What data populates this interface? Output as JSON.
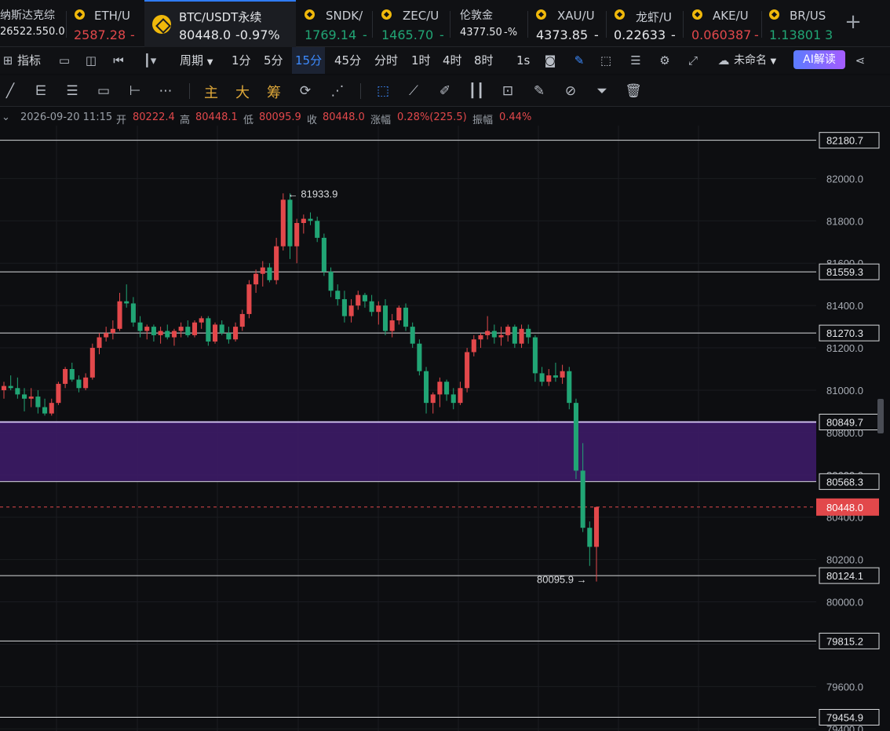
{
  "tickers": [
    {
      "name": "纳斯达克综",
      "price": "26522.55",
      "change": "0.0",
      "trend": "neu",
      "logo": "none"
    },
    {
      "name": "ETH/U",
      "price": "2587.28",
      "change": "-",
      "trend": "down",
      "logo": "coin-dot-icon"
    },
    {
      "name": "BTC/USDT永续",
      "price": "80448.0",
      "change": "-0.97%",
      "trend": "neu",
      "logo": "binance-icon",
      "active": true
    },
    {
      "name": "SNDK/",
      "price": "1769.14",
      "change": "-",
      "trend": "up",
      "logo": "coin-dot-icon"
    },
    {
      "name": "ZEC/U",
      "price": "1465.70",
      "change": "-",
      "trend": "up",
      "logo": "coin-dot-icon"
    },
    {
      "name": "伦敦金",
      "price": "4377.50",
      "change": "-%",
      "trend": "neu",
      "logo": "none"
    },
    {
      "name": "XAU/U",
      "price": "4373.85",
      "change": "-",
      "trend": "neu",
      "logo": "coin-dot-icon"
    },
    {
      "name": "龙虾/U",
      "price": "0.22633",
      "change": "-",
      "trend": "neu",
      "logo": "coin-dot-icon"
    },
    {
      "name": "AKE/U",
      "price": "0.060387",
      "change": "-",
      "trend": "down",
      "logo": "coin-dot-icon"
    },
    {
      "name": "BR/US",
      "price": "1.13801",
      "change": "3",
      "trend": "up",
      "logo": "coin-dot-icon"
    }
  ],
  "toolbar": {
    "indicators": "指标",
    "period": "周期",
    "intervals": [
      "1分",
      "5分",
      "15分",
      "45分",
      "分时",
      "1时",
      "4时",
      "8时",
      "1s"
    ],
    "active_interval": "15分",
    "layout_name": "未命名",
    "ai_label": "AI解读"
  },
  "drawbar": {
    "main": "主",
    "big": "大",
    "chip": "筹"
  },
  "info": {
    "datetime": "2026-09-20 11:15",
    "open_label": "开",
    "open": "80222.4",
    "high_label": "高",
    "high": "80448.1",
    "low_label": "低",
    "low": "80095.9",
    "close_label": "收",
    "close": "80448.0",
    "change_label": "涨幅",
    "change": "0.28%(225.5)",
    "amplitude_label": "振幅",
    "amplitude": "0.44%"
  },
  "chart_data": {
    "type": "candlestick",
    "symbol": "BTC/USDT永续",
    "interval": "15分",
    "ylim": [
      79390,
      82250
    ],
    "yticks": [
      82000.0,
      81800.0,
      81600.0,
      81400.0,
      81200.0,
      81000.0,
      80800.0,
      80600.0,
      80400.0,
      80200.0,
      80000.0,
      79800.0,
      79600.0,
      79400.0
    ],
    "horizontal_levels": [
      82180.7,
      81559.3,
      81270.3,
      80849.7,
      80568.3,
      80124.1,
      79815.2,
      79454.9
    ],
    "zone": {
      "from": 80568.3,
      "to": 80849.7,
      "color": "#3a1a63"
    },
    "last_price": 80448.0,
    "max_marker": "81933.9",
    "min_marker": "80095.9",
    "colors": {
      "up": "#e2484b",
      "down": "#21a575",
      "last": "#e2484b",
      "zone_edge": "#b78cff"
    },
    "candles": [
      [
        81000,
        81040,
        80960,
        81020
      ],
      [
        81020,
        81070,
        81000,
        81010
      ],
      [
        81010,
        81060,
        80960,
        80980
      ],
      [
        80980,
        81010,
        80900,
        80960
      ],
      [
        80960,
        81010,
        80920,
        80970
      ],
      [
        80970,
        81000,
        80890,
        80920
      ],
      [
        80920,
        80960,
        80880,
        80890
      ],
      [
        80890,
        80960,
        80880,
        80940
      ],
      [
        80940,
        81040,
        80930,
        81030
      ],
      [
        81030,
        81110,
        81010,
        81100
      ],
      [
        81100,
        81130,
        81040,
        81050
      ],
      [
        81050,
        81070,
        80990,
        81010
      ],
      [
        81010,
        81080,
        81000,
        81060
      ],
      [
        81060,
        81220,
        81050,
        81200
      ],
      [
        81200,
        81270,
        81170,
        81250
      ],
      [
        81250,
        81300,
        81230,
        81270
      ],
      [
        81270,
        81330,
        81240,
        81290
      ],
      [
        81290,
        81460,
        81280,
        81420
      ],
      [
        81420,
        81500,
        81390,
        81410
      ],
      [
        81410,
        81440,
        81300,
        81320
      ],
      [
        81320,
        81350,
        81250,
        81280
      ],
      [
        81280,
        81310,
        81240,
        81300
      ],
      [
        81300,
        81310,
        81230,
        81260
      ],
      [
        81260,
        81300,
        81220,
        81280
      ],
      [
        81280,
        81310,
        81240,
        81250
      ],
      [
        81250,
        81290,
        81210,
        81280
      ],
      [
        81280,
        81320,
        81250,
        81300
      ],
      [
        81300,
        81330,
        81250,
        81260
      ],
      [
        81260,
        81330,
        81250,
        81320
      ],
      [
        81320,
        81350,
        81290,
        81340
      ],
      [
        81340,
        81350,
        81210,
        81230
      ],
      [
        81230,
        81320,
        81220,
        81310
      ],
      [
        81310,
        81330,
        81260,
        81270
      ],
      [
        81270,
        81300,
        81220,
        81240
      ],
      [
        81240,
        81320,
        81230,
        81300
      ],
      [
        81300,
        81380,
        81280,
        81360
      ],
      [
        81360,
        81520,
        81340,
        81500
      ],
      [
        81500,
        81570,
        81460,
        81550
      ],
      [
        81550,
        81610,
        81490,
        81580
      ],
      [
        81580,
        81600,
        81510,
        81520
      ],
      [
        81520,
        81720,
        81500,
        81680
      ],
      [
        81680,
        81930,
        81660,
        81900
      ],
      [
        81900,
        81930,
        81620,
        81680
      ],
      [
        81680,
        81810,
        81600,
        81790
      ],
      [
        81790,
        81830,
        81740,
        81810
      ],
      [
        81810,
        81840,
        81780,
        81800
      ],
      [
        81800,
        81820,
        81700,
        81720
      ],
      [
        81720,
        81740,
        81540,
        81560
      ],
      [
        81560,
        81580,
        81440,
        81470
      ],
      [
        81470,
        81500,
        81400,
        81430
      ],
      [
        81430,
        81470,
        81320,
        81350
      ],
      [
        81350,
        81430,
        81320,
        81400
      ],
      [
        81400,
        81470,
        81380,
        81450
      ],
      [
        81450,
        81460,
        81390,
        81420
      ],
      [
        81420,
        81450,
        81350,
        81370
      ],
      [
        81370,
        81420,
        81310,
        81400
      ],
      [
        81400,
        81430,
        81260,
        81280
      ],
      [
        81280,
        81360,
        81250,
        81330
      ],
      [
        81330,
        81400,
        81310,
        81390
      ],
      [
        81390,
        81410,
        81280,
        81300
      ],
      [
        81300,
        81320,
        81200,
        81220
      ],
      [
        81220,
        81240,
        81070,
        81090
      ],
      [
        81090,
        81110,
        80890,
        80940
      ],
      [
        80940,
        80990,
        80890,
        80980
      ],
      [
        80980,
        81060,
        80920,
        81040
      ],
      [
        81040,
        81050,
        80950,
        80980
      ],
      [
        80980,
        81010,
        80910,
        80940
      ],
      [
        80940,
        81040,
        80930,
        81010
      ],
      [
        81010,
        81200,
        80990,
        81180
      ],
      [
        81180,
        81260,
        81160,
        81240
      ],
      [
        81240,
        81270,
        81200,
        81260
      ],
      [
        81260,
        81350,
        81240,
        81280
      ],
      [
        81280,
        81310,
        81220,
        81250
      ],
      [
        81250,
        81300,
        81210,
        81260
      ],
      [
        81260,
        81310,
        81230,
        81300
      ],
      [
        81300,
        81310,
        81200,
        81220
      ],
      [
        81220,
        81310,
        81200,
        81290
      ],
      [
        81290,
        81310,
        81220,
        81250
      ],
      [
        81250,
        81260,
        81040,
        81080
      ],
      [
        81080,
        81110,
        81020,
        81040
      ],
      [
        81040,
        81100,
        81020,
        81070
      ],
      [
        81070,
        81130,
        81040,
        81060
      ],
      [
        81060,
        81120,
        81030,
        81090
      ],
      [
        81090,
        81110,
        80910,
        80940
      ],
      [
        80940,
        80960,
        80580,
        80620
      ],
      [
        80620,
        80750,
        80330,
        80350
      ],
      [
        80350,
        80380,
        80170,
        80260
      ],
      [
        80260,
        80450,
        80096,
        80448
      ]
    ]
  }
}
